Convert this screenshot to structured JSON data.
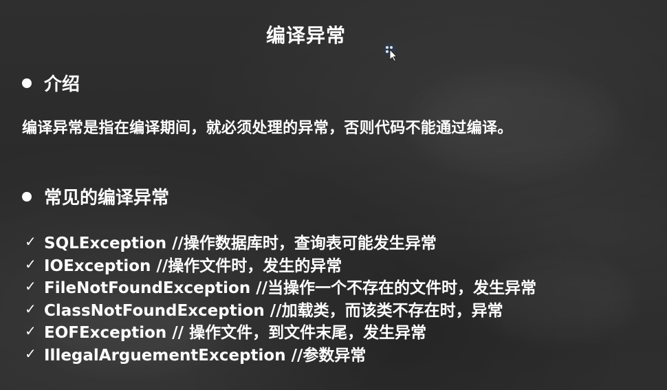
{
  "slide": {
    "title": "编译异常",
    "sections": {
      "intro": {
        "heading": "介绍",
        "text": "编译异常是指在编译期间，就必须处理的异常，否则代码不能通过编译。"
      },
      "common": {
        "heading": "常见的编译异常",
        "items": [
          "SQLException //操作数据库时，查询表可能发生异常",
          "IOException //操作文件时，发生的异常",
          "FileNotFoundException //当操作一个不存在的文件时，发生异常",
          "ClassNotFoundException //加载类，而该类不存在时，异常",
          "EOFException // 操作文件，到文件末尾，发生异常",
          "IllegalArguementException //参数异常"
        ]
      }
    },
    "check_glyph": "✓"
  },
  "colors": {
    "background": "#2d2d2d",
    "text": "#ffffff"
  }
}
